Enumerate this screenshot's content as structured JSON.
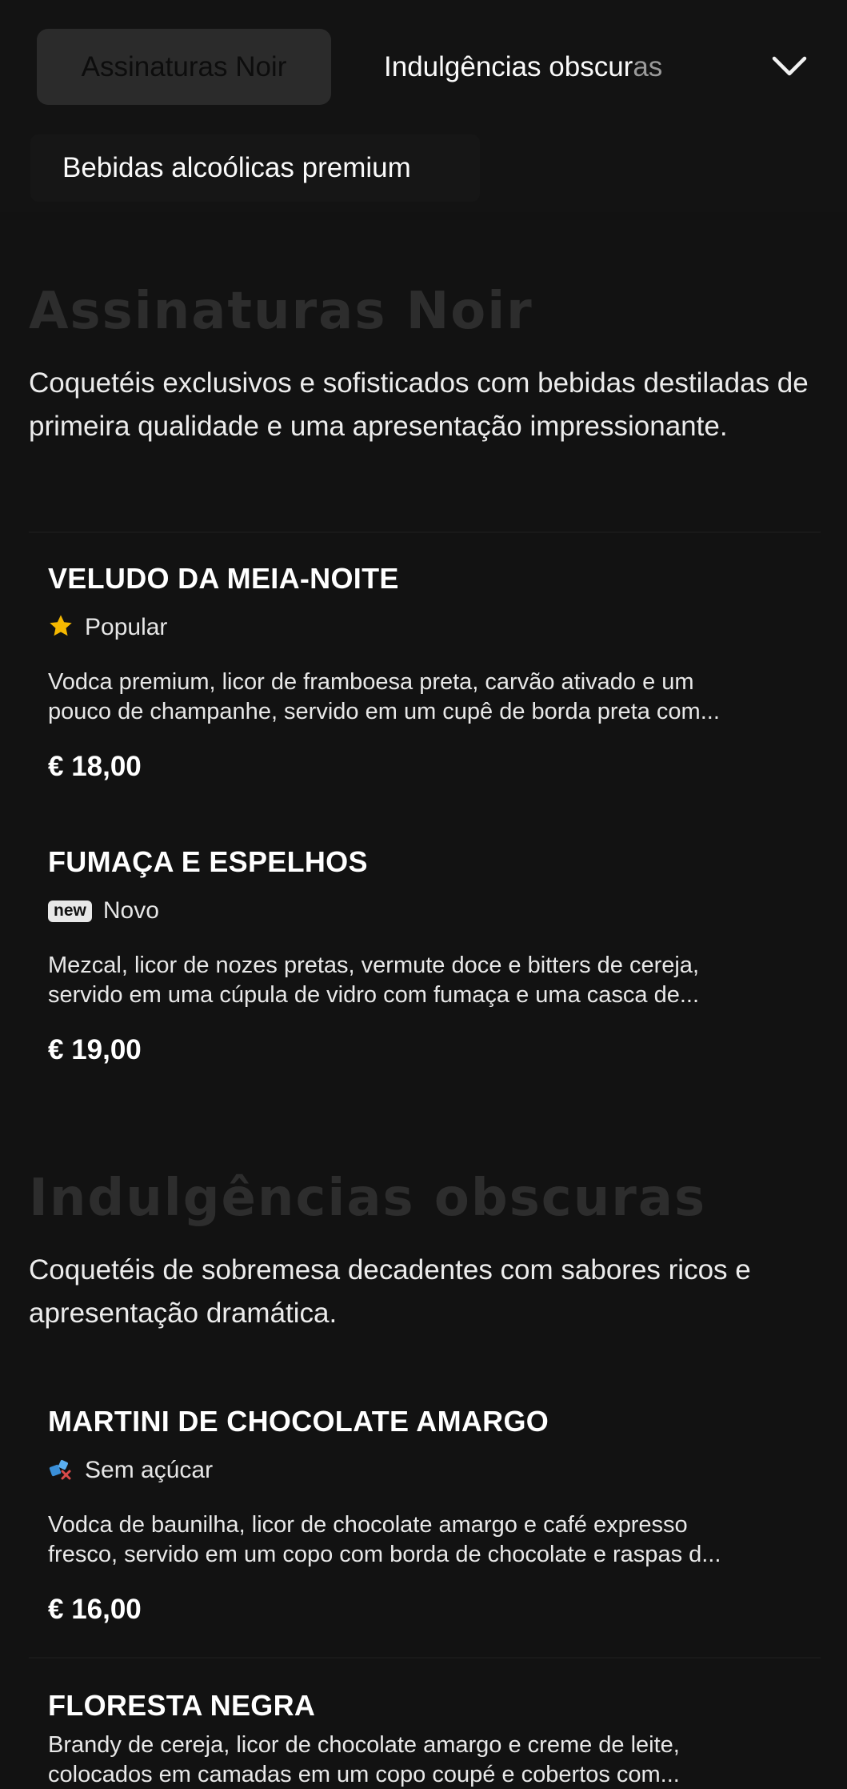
{
  "nav": {
    "tabs": [
      {
        "label": "Assinaturas Noir"
      },
      {
        "label_main": "Indulgências obscur",
        "label_fade": "as"
      },
      {
        "label": "Bebidas alcoólicas premium"
      }
    ],
    "chevron_icon": "chevron-down-icon"
  },
  "sections": [
    {
      "title": "Assinaturas Noir",
      "description": "Coquetéis exclusivos e sofisticados com bebidas destiladas de primeira qualidade e uma apresentação impressionante.",
      "items": [
        {
          "name": "VELUDO DA MEIA-NOITE",
          "badge_icon": "star-icon",
          "badge": "Popular",
          "desc_line1": "Vodca premium, licor de framboesa preta, carvão ativado e um",
          "desc_line2": "pouco de champanhe, servido em um cupê de borda preta com...",
          "price": "€ 18,00"
        },
        {
          "name": "FUMAÇA E ESPELHOS",
          "badge_icon": "new-icon",
          "badge_pill": "new",
          "badge": "Novo",
          "desc_line1": "Mezcal, licor de nozes pretas, vermute doce e bitters de cereja,",
          "desc_line2": "servido em uma cúpula de vidro com fumaça e uma casca de...",
          "price": "€ 19,00"
        }
      ]
    },
    {
      "title": "Indulgências obscuras",
      "description": "Coquetéis de sobremesa decadentes com sabores ricos e apresentação dramática.",
      "items": [
        {
          "name": "MARTINI DE CHOCOLATE AMARGO",
          "badge_icon": "sugar-free-icon",
          "badge": "Sem açúcar",
          "desc_line1": "Vodca de baunilha, licor de chocolate amargo e café expresso",
          "desc_line2": "fresco, servido em um copo com borda de chocolate e raspas d...",
          "price": "€ 16,00"
        },
        {
          "name": "FLORESTA NEGRA",
          "desc_line1": "Brandy de cereja, licor de chocolate amargo e creme de leite,",
          "desc_line2": "colocados em camadas em um copo coupé e cobertos com..."
        }
      ]
    }
  ],
  "colors": {
    "background": "#121212",
    "active_tab": "#2b2b2b",
    "star": "#f5b800",
    "sugar_free": "#3a8fd8"
  }
}
